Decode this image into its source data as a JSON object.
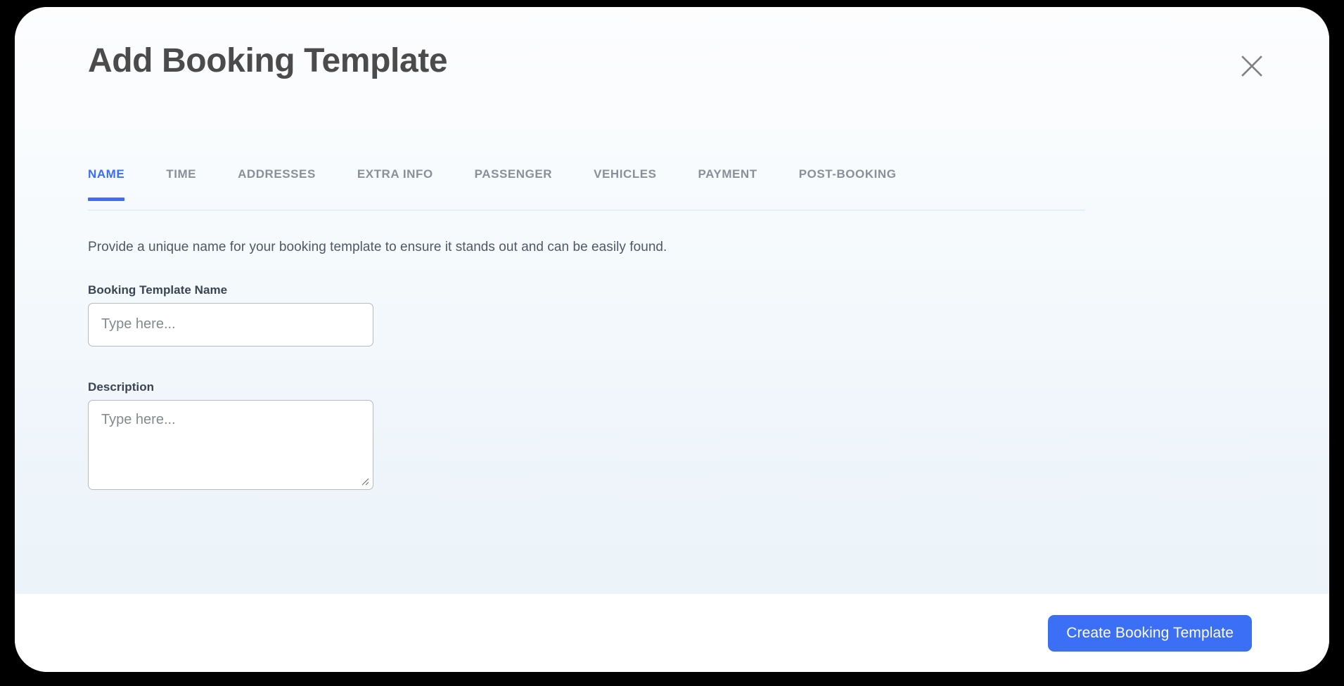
{
  "modal": {
    "title": "Add Booking Template",
    "close_icon": "close-icon"
  },
  "tabs": [
    {
      "label": "NAME",
      "active": true
    },
    {
      "label": "TIME",
      "active": false
    },
    {
      "label": "ADDRESSES",
      "active": false
    },
    {
      "label": "EXTRA INFO",
      "active": false
    },
    {
      "label": "PASSENGER",
      "active": false
    },
    {
      "label": "VEHICLES",
      "active": false
    },
    {
      "label": "PAYMENT",
      "active": false
    },
    {
      "label": "POST-BOOKING",
      "active": false
    }
  ],
  "name_panel": {
    "intro": "Provide a unique name for your booking template to ensure it stands out and can be easily found.",
    "fields": {
      "template_name": {
        "label": "Booking Template Name",
        "value": "",
        "placeholder": "Type here..."
      },
      "description": {
        "label": "Description",
        "value": "",
        "placeholder": "Type here..."
      }
    }
  },
  "footer": {
    "submit_label": "Create Booking Template"
  },
  "colors": {
    "accent": "#3b6ff6",
    "title_text": "#4b4b4b",
    "tab_inactive": "#8a9099",
    "divider": "#e2f1f8",
    "input_border": "#b7babf",
    "placeholder": "#85898e"
  }
}
